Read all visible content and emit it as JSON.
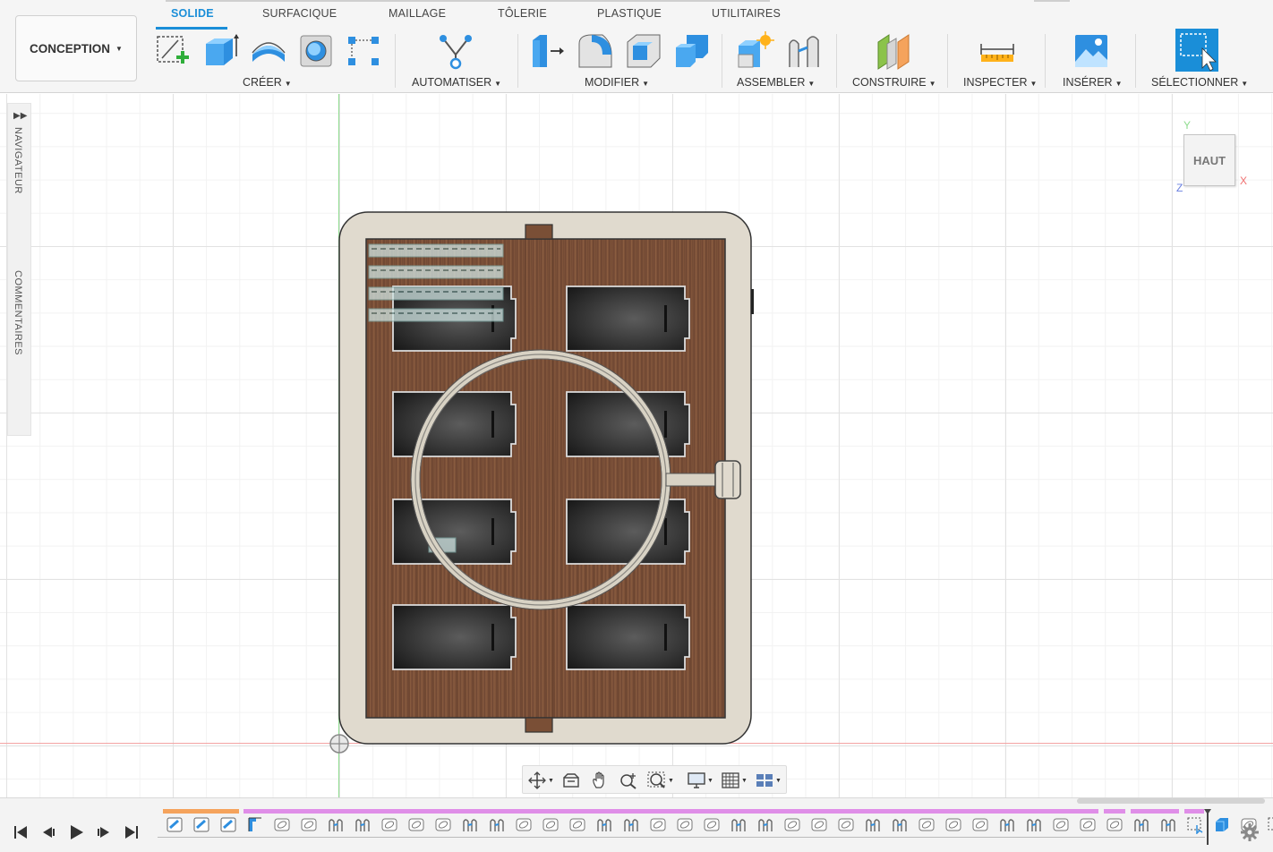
{
  "app": {
    "workspace_button": "CONCEPTION",
    "tabs": [
      {
        "label": "SOLIDE",
        "active": true
      },
      {
        "label": "SURFACIQUE"
      },
      {
        "label": "MAILLAGE"
      },
      {
        "label": "TÔLERIE"
      },
      {
        "label": "PLASTIQUE"
      },
      {
        "label": "UTILITAIRES"
      }
    ]
  },
  "toolbar": {
    "groups": {
      "creer": "CRÉER",
      "automatiser": "AUTOMATISER",
      "modifier": "MODIFIER",
      "assembler": "ASSEMBLER",
      "construire": "CONSTRUIRE",
      "inspecter": "INSPECTER",
      "inserer": "INSÉRER",
      "selectionner": "SÉLECTIONNER"
    },
    "icons": {
      "create_sketch": "create-sketch-icon",
      "extrude": "extrude-icon",
      "revolve": "revolve-icon",
      "hole": "hole-icon",
      "pattern": "pattern-icon",
      "automate": "automate-icon",
      "press_pull": "press-pull-icon",
      "fillet": "fillet-icon",
      "shell": "shell-icon",
      "combine": "combine-icon",
      "new_component": "new-component-icon",
      "joint": "joint-icon",
      "offset_plane": "offset-plane-icon",
      "measure": "measure-icon",
      "insert_image": "insert-image-icon",
      "select": "select-icon"
    },
    "accent_color": "#1a8ed8"
  },
  "side_panel": {
    "navigator": "NAVIGATEUR",
    "comments": "COMMENTAIRES"
  },
  "viewcube": {
    "face": "HAUT",
    "axis_y": "Y",
    "axis_x": "X",
    "axis_z": "Z"
  },
  "model_colors": {
    "frame": "#e0dace",
    "wood": "#7a4f36",
    "pocket": "#2c2c2c",
    "ring": "#bdb7aa"
  },
  "nav_tools": [
    "orbit-icon",
    "look-at-icon",
    "pan-icon",
    "zoom-icon",
    "fit-icon",
    "display-settings-icon",
    "grid-settings-icon",
    "viewports-icon"
  ],
  "timeline": {
    "controls": [
      "go-to-start-icon",
      "step-back-icon",
      "play-icon",
      "step-forward-icon",
      "go-to-end-icon"
    ],
    "settings_icon": "gear-icon",
    "strip_colors": {
      "orange": "#f5a35c",
      "pink": "#df8ee8"
    }
  }
}
